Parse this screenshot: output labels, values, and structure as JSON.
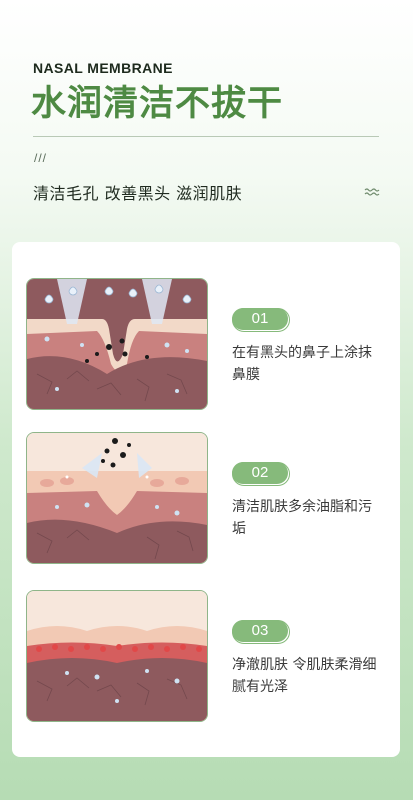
{
  "header": {
    "eyebrow": "NASAL MEMBRANE",
    "title": "水润清洁不拔干",
    "slashes": "///",
    "subtitle": "清洁毛孔 改善黑头 滋润肌肤",
    "accent_color": "#4e8a43"
  },
  "steps": [
    {
      "number": "01",
      "text": "在有黑头的鼻子上涂抹鼻膜"
    },
    {
      "number": "02",
      "text": "清洁肌肤多余油脂和污垢"
    },
    {
      "number": "03",
      "text": "净澈肌肤 令肌肤柔滑细腻有光泽"
    }
  ],
  "colors": {
    "badge": "#86ba7b",
    "skin_top": "#f2d9c8",
    "skin_mid": "#c9817f",
    "skin_deep": "#8e5a5e"
  }
}
